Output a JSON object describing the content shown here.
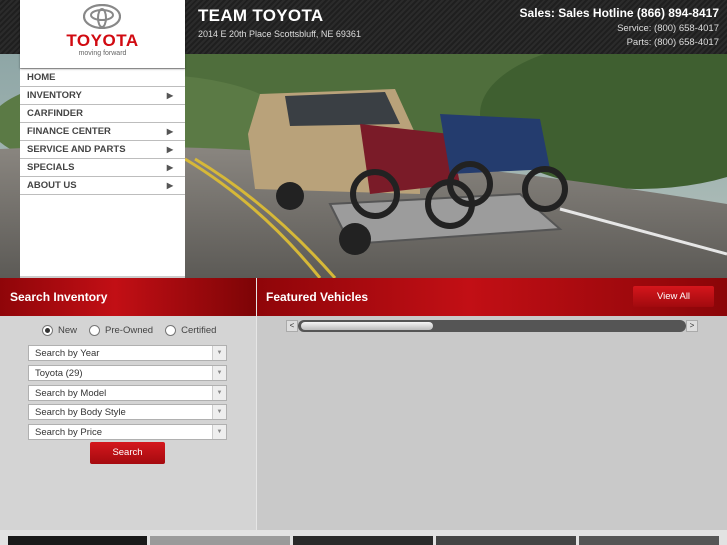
{
  "header": {
    "dealer_name": "TEAM TOYOTA",
    "address": "2014 E 20th Place Scottsbluff, NE 69361",
    "sales": "Sales: Sales Hotline (866) 894-8417",
    "service": "Service: (800) 658-4017",
    "parts": "Parts: (800) 658-4017"
  },
  "logo": {
    "word": "TOYOTA",
    "tagline": "moving forward",
    "icon": "toyota-emblem"
  },
  "nav": {
    "items": [
      {
        "label": "HOME",
        "has_arrow": false
      },
      {
        "label": "INVENTORY",
        "has_arrow": true
      },
      {
        "label": "CARFINDER",
        "has_arrow": false
      },
      {
        "label": "FINANCE CENTER",
        "has_arrow": true
      },
      {
        "label": "SERVICE AND PARTS",
        "has_arrow": true
      },
      {
        "label": "SPECIALS",
        "has_arrow": true
      },
      {
        "label": "ABOUT US",
        "has_arrow": true
      }
    ]
  },
  "search": {
    "title": "Search Inventory",
    "conditions": [
      {
        "label": "New",
        "selected": true
      },
      {
        "label": "Pre-Owned",
        "selected": false
      },
      {
        "label": "Certified",
        "selected": false
      }
    ],
    "selects": [
      {
        "value": "Search by Year"
      },
      {
        "value": "Toyota (29)"
      },
      {
        "value": "Search by Model"
      },
      {
        "value": "Search by Body Style"
      },
      {
        "value": "Search by Price"
      }
    ],
    "button": "Search"
  },
  "featured": {
    "title": "Featured Vehicles",
    "view_all": "View All",
    "scroll_left": "<",
    "scroll_right": ">"
  },
  "colors": {
    "brand_red": "#c20f15",
    "header_dark": "#1f1f1f"
  }
}
